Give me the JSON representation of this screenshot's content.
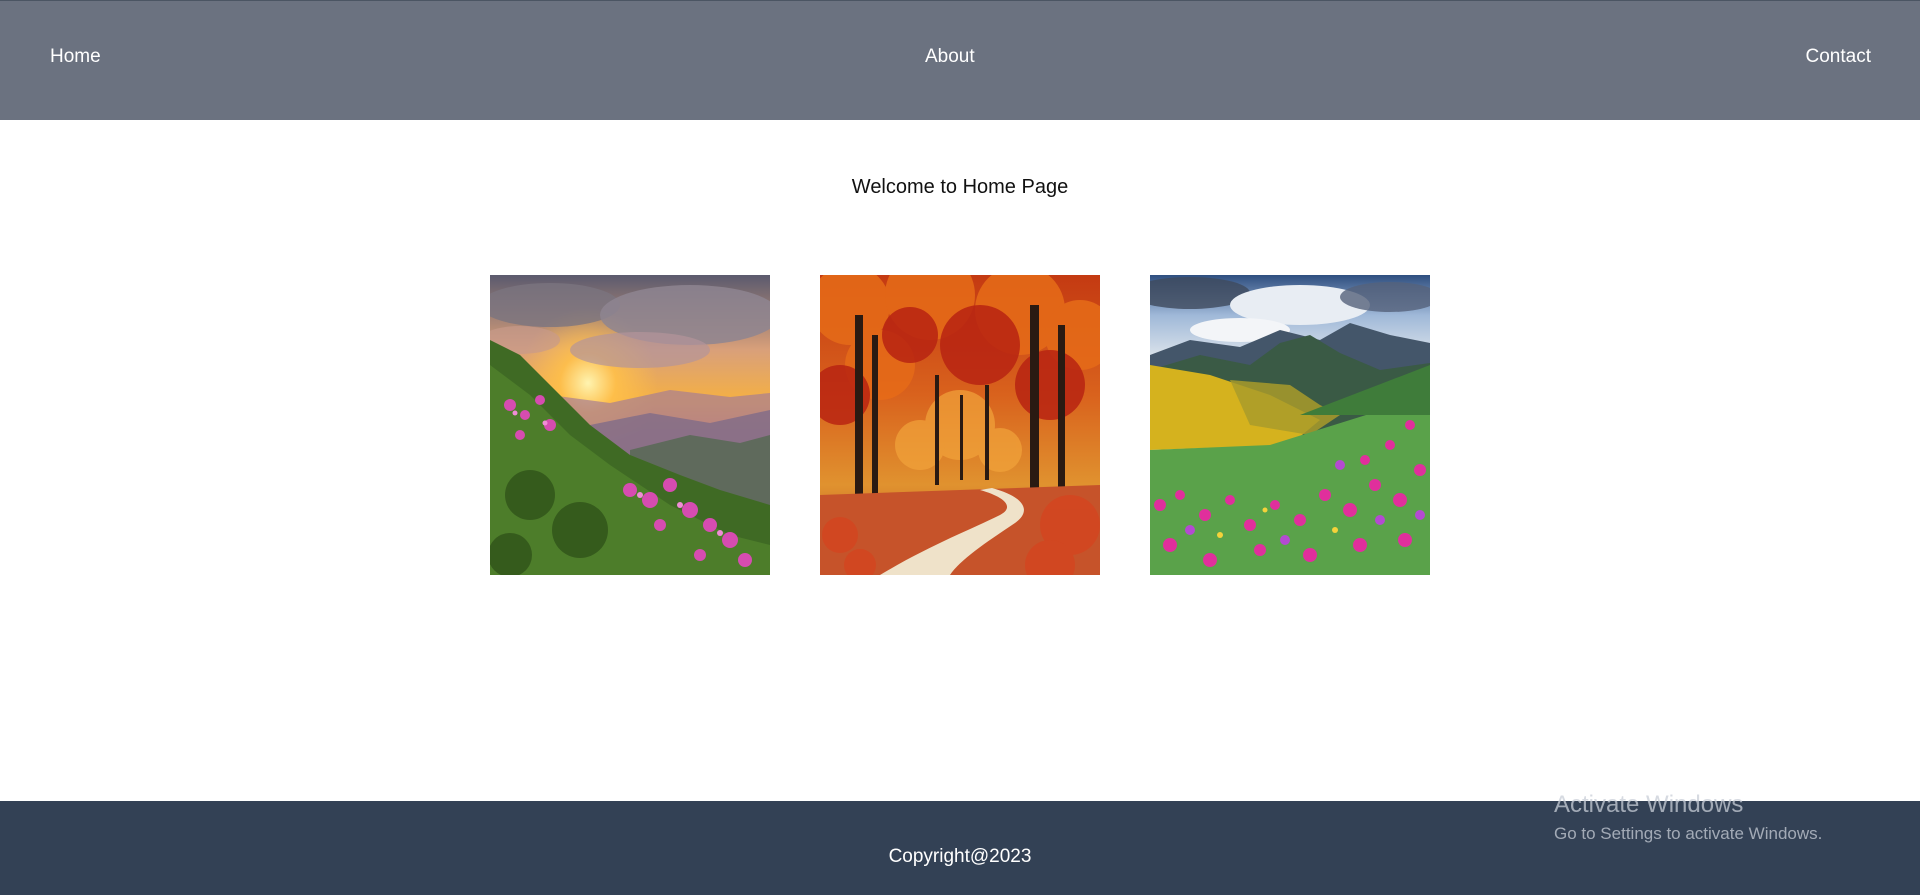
{
  "nav": {
    "home_label": "Home",
    "about_label": "About",
    "contact_label": "Contact"
  },
  "main": {
    "welcome_text": "Welcome to Home Page",
    "gallery": [
      {
        "icon": "landscape-sunset-flowers-image"
      },
      {
        "icon": "autumn-forest-path-image"
      },
      {
        "icon": "mountain-meadow-flowers-image"
      }
    ]
  },
  "footer": {
    "copyright": "Copyright@2023"
  },
  "watermark": {
    "title": "Activate Windows",
    "subtitle": "Go to Settings to activate Windows."
  },
  "colors": {
    "navbar_bg": "#6b7280",
    "footer_bg": "#334155",
    "page_bg": "#ffffff",
    "nav_text": "#ffffff"
  }
}
